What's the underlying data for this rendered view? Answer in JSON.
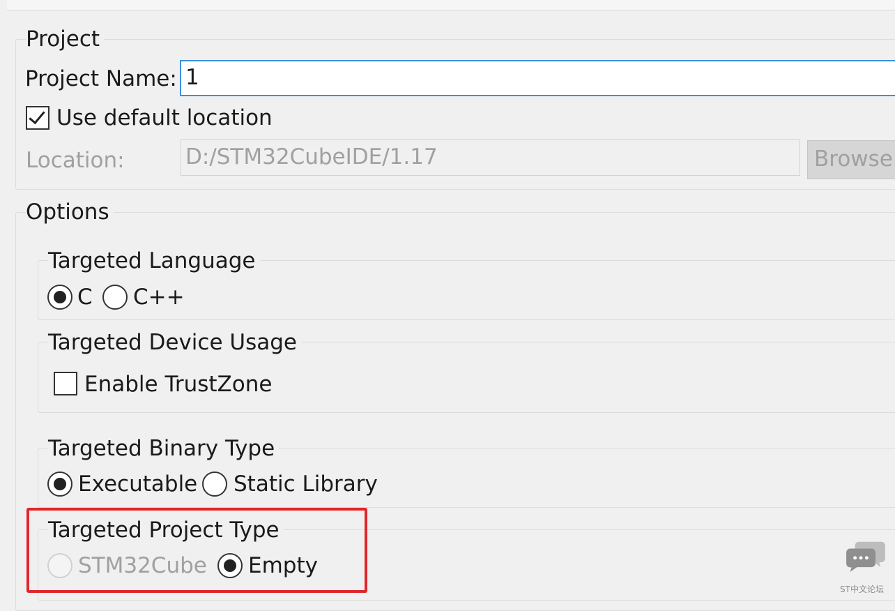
{
  "project": {
    "legend": "Project",
    "name_label": "Project Name:",
    "name_value": "1",
    "use_default_location_label": "Use default location",
    "use_default_location_checked": true,
    "location_label": "Location:",
    "location_value": "D:/STM32CubeIDE/1.17",
    "browse_label": "Browse..."
  },
  "options": {
    "legend": "Options",
    "language": {
      "legend": "Targeted Language",
      "options": [
        {
          "label": "C",
          "selected": true
        },
        {
          "label": "C++",
          "selected": false
        }
      ]
    },
    "device_usage": {
      "legend": "Targeted Device Usage",
      "trustzone_label": "Enable TrustZone",
      "trustzone_checked": false
    },
    "binary_type": {
      "legend": "Targeted Binary Type",
      "options": [
        {
          "label": "Executable",
          "selected": true
        },
        {
          "label": "Static Library",
          "selected": false
        }
      ]
    },
    "project_type": {
      "legend": "Targeted Project Type",
      "options": [
        {
          "label": "STM32Cube",
          "selected": false,
          "enabled": false
        },
        {
          "label": "Empty",
          "selected": true,
          "enabled": true
        }
      ]
    }
  },
  "watermark": {
    "icon": "chat-bubbles-icon",
    "text": "ST中文论坛"
  },
  "colors": {
    "focus_border": "#3c8fdd",
    "highlight_box": "#e0262c",
    "disabled_text": "#a0a0a0"
  }
}
